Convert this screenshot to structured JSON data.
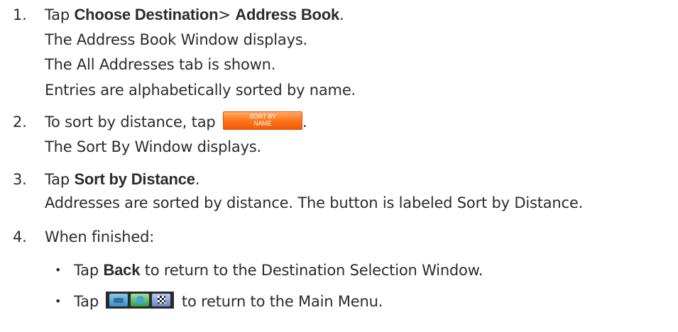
{
  "steps": [
    {
      "number": "1.",
      "prefix": "Tap ",
      "bold1": "Choose Destination",
      "sep": "> ",
      "bold2": "Address Book",
      "suffix": ".",
      "lines": [
        "The Address Book Window displays.",
        "The All  Addresses tab is shown.",
        "Entries are alphabetically sorted by name."
      ]
    },
    {
      "number": "2.",
      "prefix": "To sort by distance, tap",
      "button": {
        "line1": "SORT BY",
        "line2": "NAME",
        "color": "#f2600f"
      },
      "suffix": ".",
      "lines": [
        "The Sort By Window displays."
      ]
    },
    {
      "number": "3.",
      "prefix": "Tap ",
      "bold": "Sort by Distance",
      "suffix": ".",
      "lines": [
        "Addresses are sorted by distance. The button is labeled Sort by Distance."
      ]
    },
    {
      "number": "4.",
      "text": "When finished:",
      "bullets": [
        {
          "marker": "•",
          "prefix": "Tap ",
          "bold": "Back",
          "suffix": " to return to the Destination Selection Window."
        },
        {
          "marker": "•",
          "prefix": "Tap",
          "icons": [
            "car-icon",
            "globe-icon",
            "checkered-flag-icon"
          ],
          "suffix": " to return to the Main Menu."
        }
      ]
    }
  ]
}
